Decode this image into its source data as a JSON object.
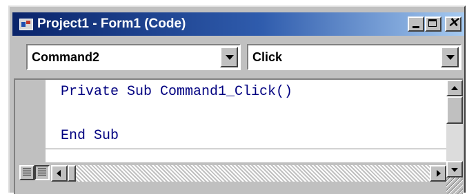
{
  "window": {
    "title": "Project1 - Form1 (Code)"
  },
  "title_buttons": {
    "close_glyph": "✕"
  },
  "object_combo": {
    "selected": "Command2"
  },
  "procedure_combo": {
    "selected": "Click"
  },
  "code": {
    "lines": [
      "Private Sub Command1_Click()",
      "End Sub"
    ],
    "text_color": "#000080"
  },
  "colors": {
    "titlebar_start": "#0a246a",
    "titlebar_end": "#a6caf0",
    "window_face": "#c0c0c0"
  },
  "icons": {
    "app": "vb-project-icon",
    "minimize": "minimize-icon",
    "maximize": "maximize-icon",
    "close": "close-icon",
    "dropdown": "chevron-down-icon",
    "procedure_view": "procedure-view-icon",
    "module_view": "full-module-view-icon"
  }
}
